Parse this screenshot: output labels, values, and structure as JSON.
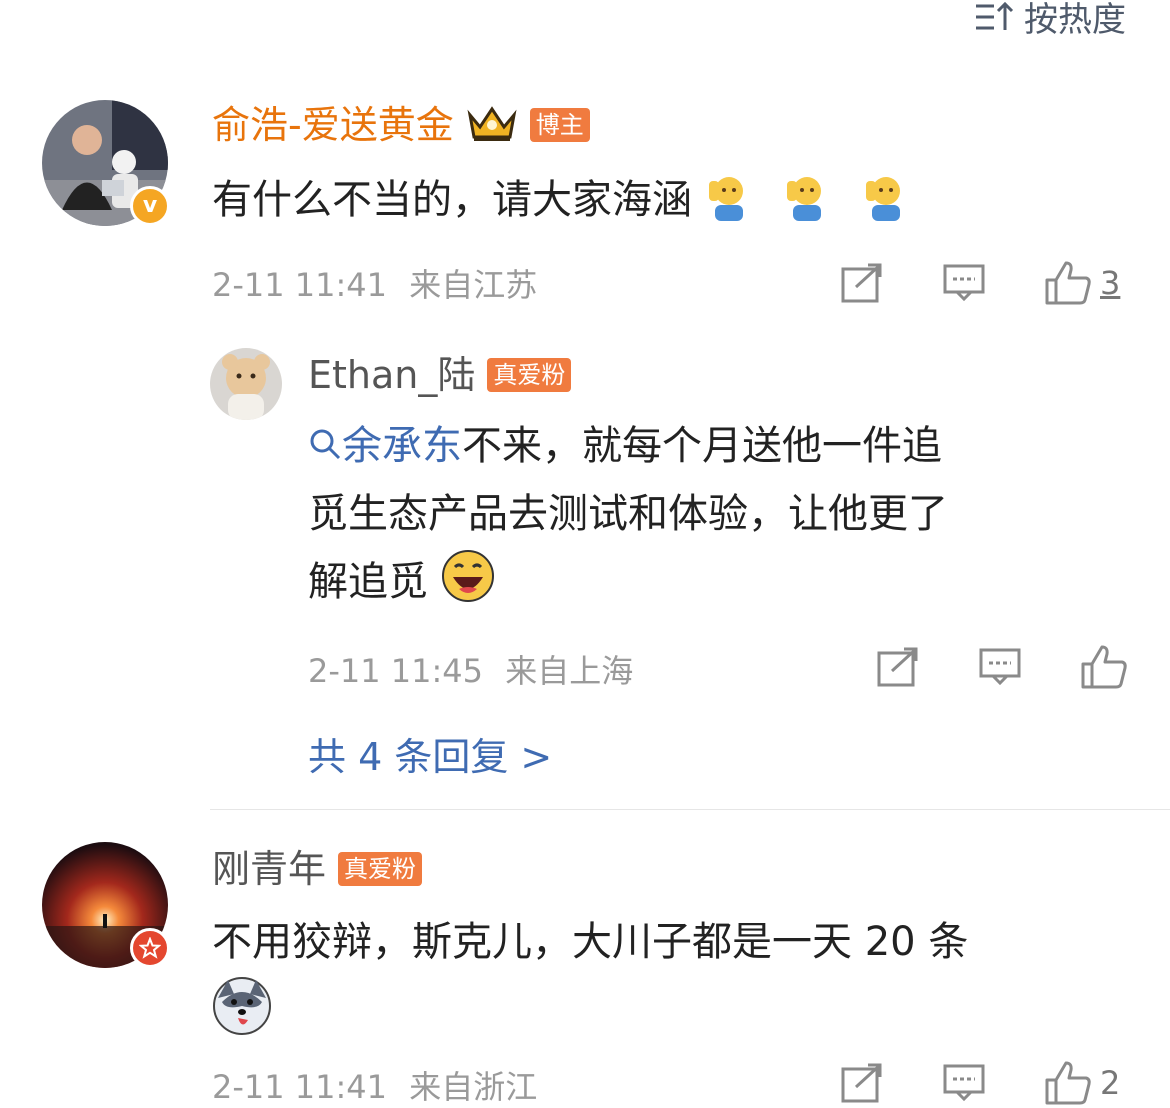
{
  "sort": {
    "label": "按热度"
  },
  "comments": [
    {
      "user": "俞浩-爱送黄金",
      "tag": "博主",
      "text": "有什么不当的，请大家海涵",
      "time": "2-11 11:41",
      "location": "来自江苏",
      "likes": "3",
      "name_color": "#e8740c"
    },
    {
      "user": "刚青年",
      "tag": "真爱粉",
      "text": "不用狡辩，斯克儿，大川子都是一天 20 条",
      "time": "2-11 11:41",
      "location": "来自浙江",
      "likes": "2",
      "name_color": "#555555"
    }
  ],
  "reply": {
    "user": "Ethan_陆",
    "tag": "真爱粉",
    "mention": "余承东",
    "text_line1": "不来，就每个月送他一件追",
    "text_line2": "觅生态产品去测试和体验，让他更了",
    "text_line3": "解追觅",
    "time": "2-11 11:45",
    "location": "来自上海"
  },
  "more_replies": "共 4 条回复 >",
  "colors": {
    "accent_blue": "#3f6bb2",
    "tag_orange": "#f07b3f",
    "verified_yellow": "#f5a623",
    "red_badge": "#e4472f"
  }
}
